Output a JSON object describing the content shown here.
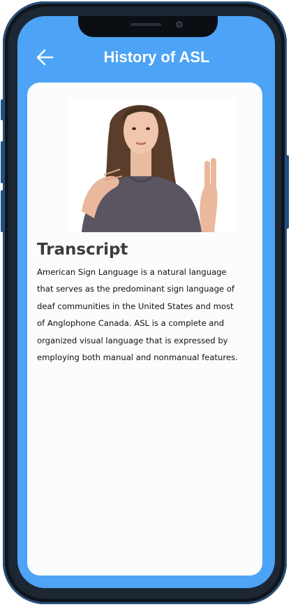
{
  "header": {
    "title": "History of ASL",
    "back_icon": "arrow-left-icon"
  },
  "media": {
    "image_subject": "woman demonstrating a sign"
  },
  "transcript": {
    "heading": "Transcript",
    "body": "American Sign Language is a natural language\nthat serves as  the predominant sign language of\ndeaf communities in the United States  and most\nof Anglophone Canada. ASL is a complete and\norganized visual  language that is expressed by\nemploying both manual and nonmanual  features."
  },
  "colors": {
    "accent": "#4da3f5",
    "card": "#fbfcfe",
    "frame": "#1d2733"
  }
}
